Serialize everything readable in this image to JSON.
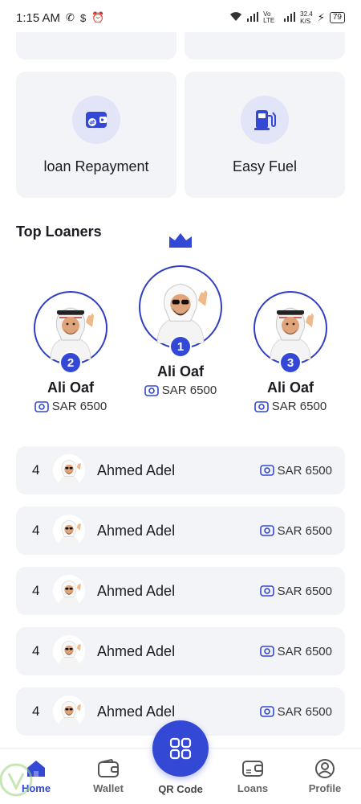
{
  "status_bar": {
    "time": "1:15 AM",
    "speed": "32.4",
    "speed_unit": "K/S",
    "battery": "79",
    "network": "Vo LTE"
  },
  "services": [
    {
      "label": "loan Repayment",
      "icon": "wallet-transfer-icon"
    },
    {
      "label": "Easy Fuel",
      "icon": "fuel-pump-icon"
    }
  ],
  "top_loaners_title": "Top Loaners",
  "podium": [
    {
      "rank": "2",
      "name": "Ali Oaf",
      "amount": "SAR 6500"
    },
    {
      "rank": "1",
      "name": "Ali Oaf",
      "amount": "SAR 6500"
    },
    {
      "rank": "3",
      "name": "Ali Oaf",
      "amount": "SAR 6500"
    }
  ],
  "list": [
    {
      "rank": "4",
      "name": "Ahmed Adel",
      "amount": "SAR 6500"
    },
    {
      "rank": "4",
      "name": "Ahmed Adel",
      "amount": "SAR 6500"
    },
    {
      "rank": "4",
      "name": "Ahmed Adel",
      "amount": "SAR 6500"
    },
    {
      "rank": "4",
      "name": "Ahmed Adel",
      "amount": "SAR 6500"
    },
    {
      "rank": "4",
      "name": "Ahmed Adel",
      "amount": "SAR 6500"
    }
  ],
  "nav": [
    {
      "label": "Home",
      "icon": "home-icon",
      "active": true
    },
    {
      "label": "Wallet",
      "icon": "wallet-icon"
    },
    {
      "label": "QR Code",
      "icon": "qr-code-icon"
    },
    {
      "label": "Loans",
      "icon": "loans-icon"
    },
    {
      "label": "Profile",
      "icon": "profile-icon"
    }
  ],
  "colors": {
    "accent": "#3448d6",
    "card_bg": "#f3f4f8",
    "icon_bg": "#e2e4f7"
  }
}
